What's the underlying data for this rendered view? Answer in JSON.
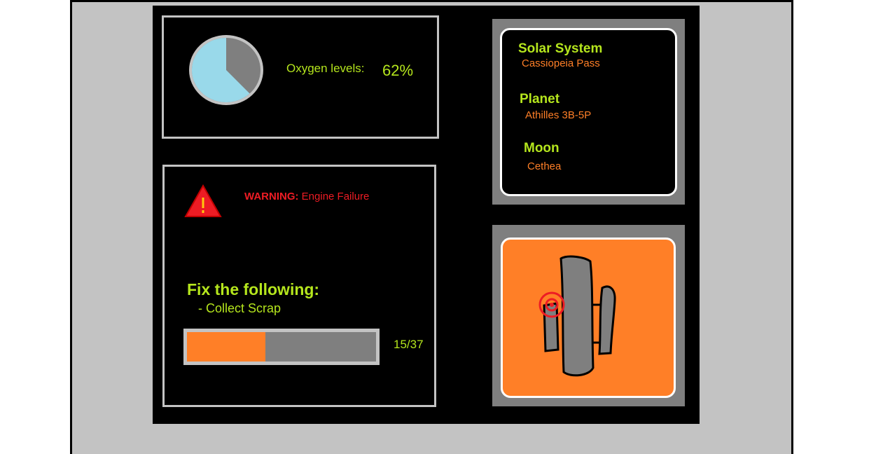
{
  "oxygen": {
    "label": "Oxygen levels:",
    "value_text": "62%",
    "level_percent": 62
  },
  "warning": {
    "prefix": "WARNING:",
    "message": " Engine Failure"
  },
  "task": {
    "title": "Fix the following:",
    "item": "- Collect Scrap",
    "collected": 15,
    "total": 37,
    "count_text": "15/37"
  },
  "location": {
    "solar_system_label": "Solar System",
    "solar_system_value": "Cassiopeia Pass",
    "planet_label": "Planet",
    "planet_value": "Athilles 3B-5P",
    "moon_label": "Moon",
    "moon_value": "Cethea"
  },
  "colors": {
    "accent_green": "#b5e61d",
    "accent_orange": "#ff7f27",
    "warning_red": "#ed1c24",
    "oxygen_blue": "#99d9ea",
    "panel_gray": "#7f7f7f"
  }
}
